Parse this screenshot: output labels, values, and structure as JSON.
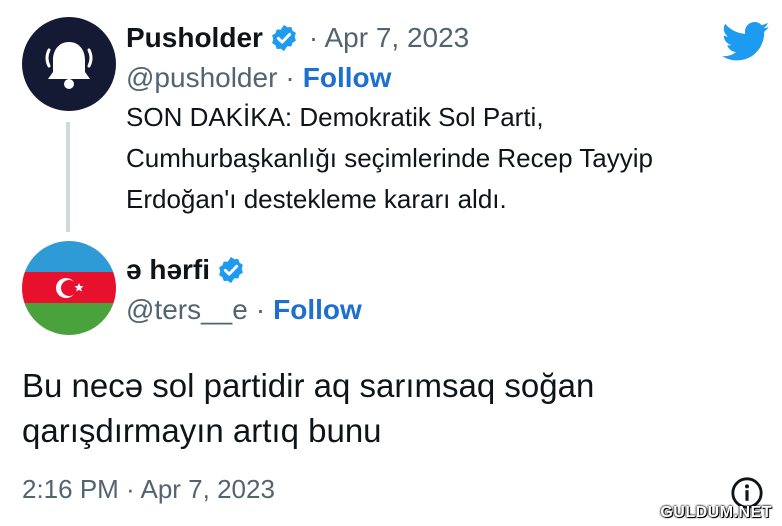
{
  "tweet": {
    "author_name": "Pusholder",
    "date": "· Apr 7, 2023",
    "handle": "@pusholder",
    "separator": "·",
    "follow": "Follow",
    "text_lines": [
      "SON DAKİKA: Demokratik Sol Parti,",
      "Cumhurbaşkanlığı seçimlerinde Recep Tayyip",
      "Erdoğan'ı destekleme kararı aldı."
    ]
  },
  "reply": {
    "author_name": "ə hərfi",
    "handle": "@ters__e",
    "separator": "·",
    "follow": "Follow",
    "text_lines": [
      "Bu necə sol partidir aq sarımsaq soğan",
      "qarışdırmayın artıq bunu"
    ],
    "timestamp": "2:16 PM · Apr 7, 2023"
  },
  "watermark": "GULDUM.NET",
  "colors": {
    "follow": "#1d6fd0",
    "verified": "#1d9bf0",
    "twitter": "#1d9bf0",
    "muted": "#536471",
    "flag_blue": "#2e9bd6",
    "flag_red": "#e8112d",
    "flag_green": "#4aa23c"
  }
}
